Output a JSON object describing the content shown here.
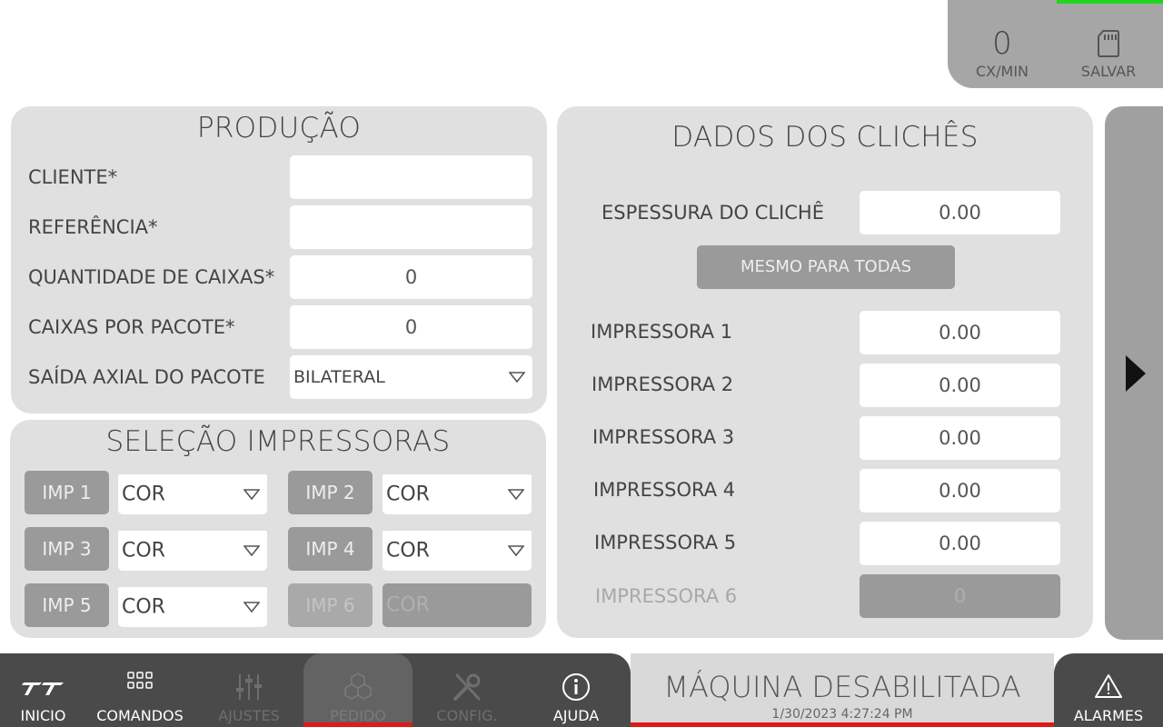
{
  "top_status": {
    "rate_value": "0",
    "rate_label": "CX/MIN",
    "save_label": "SALVAR",
    "save_icon": "sd-card-icon"
  },
  "producao": {
    "title": "PRODUÇÃO",
    "cliente_label": "CLIENTE*",
    "cliente_value": "",
    "referencia_label": "REFERÊNCIA*",
    "referencia_value": "",
    "quantidade_label": "QUANTIDADE DE CAIXAS*",
    "quantidade_value": "0",
    "caixas_pacote_label": "CAIXAS POR PACOTE*",
    "caixas_pacote_value": "0",
    "saida_label": "SAÍDA AXIAL DO PACOTE",
    "saida_value": "BILATERAL"
  },
  "selecao": {
    "title": "SELEÇÃO IMPRESSORAS",
    "printers": [
      {
        "label": "IMP 1",
        "color": "COR",
        "enabled": true
      },
      {
        "label": "IMP 2",
        "color": "COR",
        "enabled": true
      },
      {
        "label": "IMP 3",
        "color": "COR",
        "enabled": true
      },
      {
        "label": "IMP 4",
        "color": "COR",
        "enabled": true
      },
      {
        "label": "IMP 5",
        "color": "COR",
        "enabled": true
      },
      {
        "label": "IMP 6",
        "color": "COR",
        "enabled": false
      }
    ]
  },
  "cliches": {
    "title": "DADOS DOS CLICHÊS",
    "espessura_label": "ESPESSURA DO CLICHÊ",
    "espessura_value": "0.00",
    "same_all_button": "MESMO PARA TODAS",
    "printers": [
      {
        "label": "IMPRESSORA 1",
        "value": "0.00",
        "enabled": true
      },
      {
        "label": "IMPRESSORA 2",
        "value": "0.00",
        "enabled": true
      },
      {
        "label": "IMPRESSORA 3",
        "value": "0.00",
        "enabled": true
      },
      {
        "label": "IMPRESSORA 4",
        "value": "0.00",
        "enabled": true
      },
      {
        "label": "IMPRESSORA 5",
        "value": "0.00",
        "enabled": true
      },
      {
        "label": "IMPRESSORA 6",
        "value": "0",
        "enabled": false
      }
    ]
  },
  "nav": {
    "items": [
      {
        "label": "INICIO",
        "icon": "logo-icon",
        "enabled": true
      },
      {
        "label": "COMANDOS",
        "icon": "grid-icon",
        "enabled": true
      },
      {
        "label": "AJUSTES",
        "icon": "sliders-icon",
        "enabled": false
      },
      {
        "label": "PEDIDO",
        "icon": "cubes-icon",
        "enabled": false,
        "active": true
      },
      {
        "label": "CONFIG.",
        "icon": "tools-icon",
        "enabled": false
      },
      {
        "label": "AJUDA",
        "icon": "info-icon",
        "enabled": true
      }
    ],
    "alarm_label": "ALARMES"
  },
  "status": {
    "text": "MÁQUINA DESABILITADA",
    "timestamp": "1/30/2023 4:27:24 PM"
  },
  "colors": {
    "panel_bg": "#e0e0e0",
    "nav_bg": "#4a4a4a",
    "alert_red": "#e01919",
    "ok_green": "#1fd61f"
  }
}
